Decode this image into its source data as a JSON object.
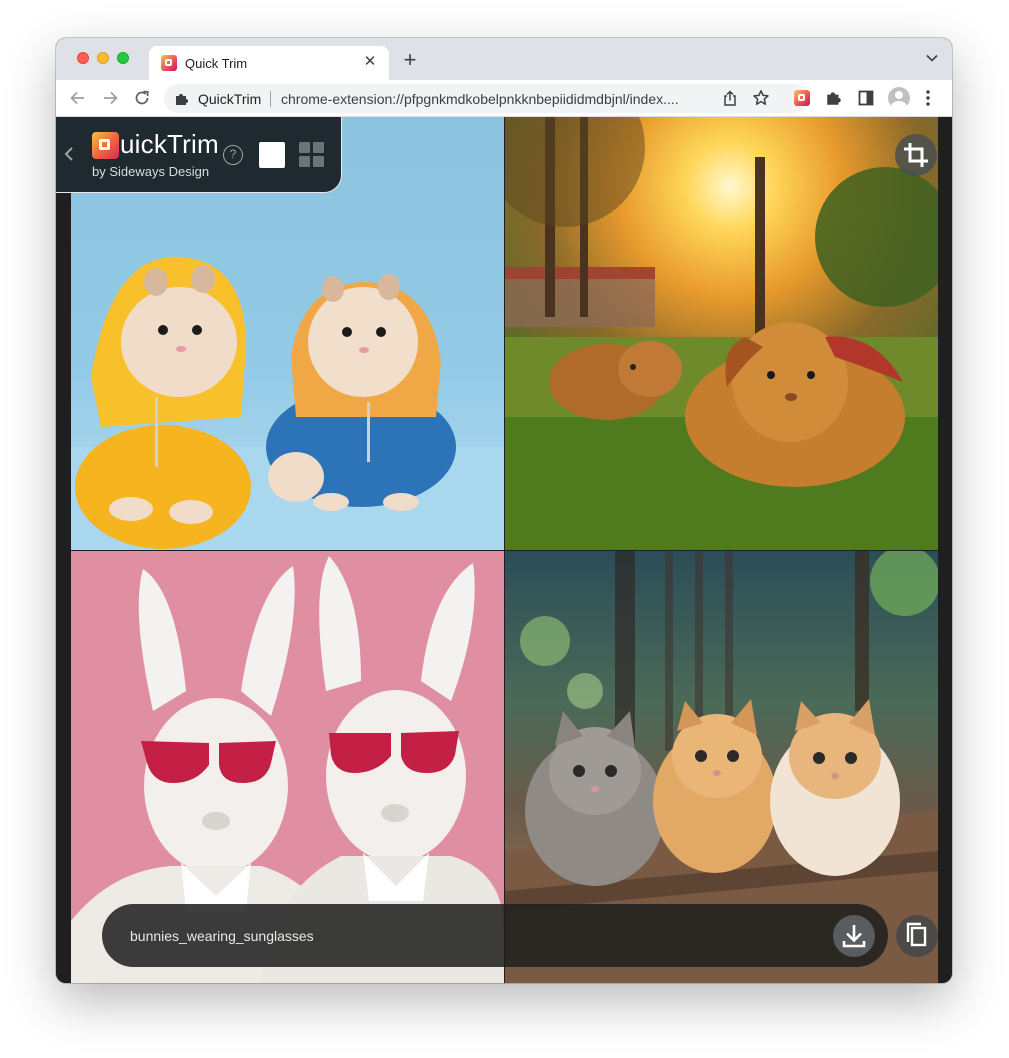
{
  "browser": {
    "tab_title": "Quick Trim",
    "new_tab_symbol": "+",
    "close_symbol": "✕",
    "extension_name": "QuickTrim",
    "url": "chrome-extension://pfpgnkmdkobelpnkknbepiididmdbjnl/index...."
  },
  "app": {
    "logo_letter": "Q",
    "logo_rest": "uickTrim",
    "byline": "by Sideways Design",
    "help_symbol": "?",
    "view_modes": [
      "single-view",
      "grid-view"
    ],
    "active_view": "grid-view"
  },
  "images": [
    {
      "subject": "hamsters in hoodies",
      "position": "top-left"
    },
    {
      "subject": "bunnies on grass",
      "position": "top-right"
    },
    {
      "subject": "bunnies wearing sunglasses",
      "position": "bottom-left"
    },
    {
      "subject": "fluffy kittens",
      "position": "bottom-right"
    }
  ],
  "footer": {
    "filename": "bunnies_wearing_sunglasses"
  },
  "colors": {
    "panel_bg": "#1e2a2f",
    "brand_gradient_start": "#f5c542",
    "brand_gradient_end": "#d02c54",
    "tabstrip": "#dee1e6"
  },
  "icons": {
    "crop": "crop-icon",
    "download": "download-icon",
    "copy": "copy-icon"
  }
}
